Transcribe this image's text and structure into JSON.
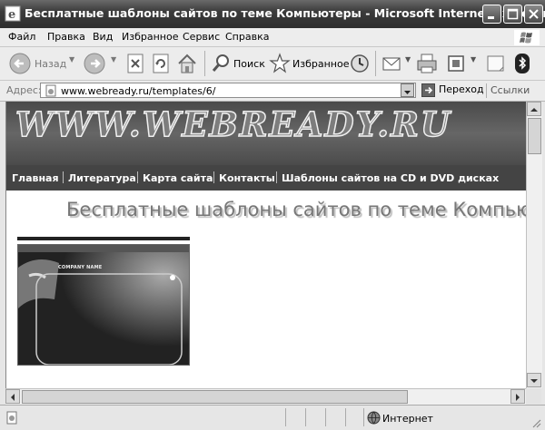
{
  "window": {
    "title": "Бесплатные шаблоны сайтов по теме Компьютеры - Microsoft Internet Explorer"
  },
  "menu": {
    "items": [
      {
        "label": "Файл"
      },
      {
        "label": "Правка"
      },
      {
        "label": "Вид"
      },
      {
        "label": "Избранное"
      },
      {
        "label": "Сервис"
      },
      {
        "label": "Справка"
      }
    ]
  },
  "toolbar": {
    "back_label": "Назад",
    "search_label": "Поиск",
    "favorites_label": "Избранное"
  },
  "address": {
    "label": "Адрес:",
    "url": "www.webready.ru/templates/6/",
    "go_label": "Переход",
    "links_label": "Ссылки"
  },
  "page": {
    "logo_text": "WWW.WEBREADY.RU",
    "nav": [
      {
        "label": "Главная"
      },
      {
        "label": "Литература"
      },
      {
        "label": "Карта сайта"
      },
      {
        "label": "Контакты"
      },
      {
        "label": "Шаблоны сайтов на CD и DVD дисках"
      }
    ],
    "title": "Бесплатные шаблоны сайтов по теме Компьютеры",
    "template_company": "COMPANY NAME"
  },
  "status": {
    "zone": "Интернет"
  },
  "icons": [
    "ie-icon",
    "minimize-icon",
    "maximize-icon",
    "close-icon",
    "windows-logo-icon",
    "back-icon",
    "forward-icon",
    "stop-icon",
    "refresh-icon",
    "home-icon",
    "search-icon",
    "favorites-icon",
    "history-icon",
    "mail-icon",
    "print-icon",
    "edit-icon",
    "discuss-icon",
    "bluetooth-icon",
    "page-icon",
    "globe-icon"
  ]
}
